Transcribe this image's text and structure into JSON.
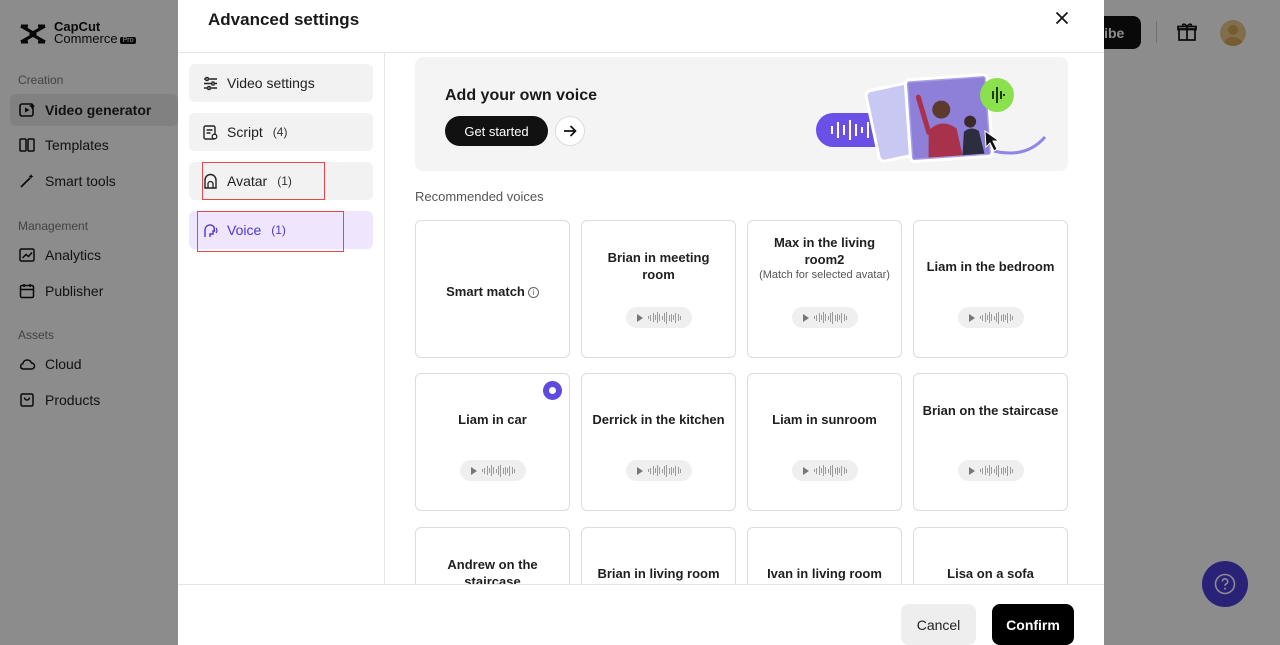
{
  "app": {
    "logo_line1": "CapCut",
    "logo_line2": "Commerce",
    "logo_badge": "Pro",
    "subscribe_label": "ribe",
    "sections": [
      {
        "label": "Creation",
        "items": [
          "Video generator",
          "Templates",
          "Smart tools"
        ]
      },
      {
        "label": "Management",
        "items": [
          "Analytics",
          "Publisher"
        ]
      },
      {
        "label": "Assets",
        "items": [
          "Cloud",
          "Products"
        ]
      }
    ],
    "accent_color": "#4c3ed8"
  },
  "modal": {
    "title": "Advanced settings",
    "nav": [
      {
        "label": "Video settings",
        "count": ""
      },
      {
        "label": "Script",
        "count": "(4)"
      },
      {
        "label": "Avatar",
        "count": "(1)"
      },
      {
        "label": "Voice",
        "count": "(1)"
      }
    ],
    "active_nav": "Voice",
    "banner": {
      "title": "Add your own voice",
      "button_label": "Get started"
    },
    "section_label": "Recommended voices",
    "voices": [
      {
        "name": "Smart match",
        "note": "",
        "selected": false
      },
      {
        "name": "Brian in meeting room",
        "note": "",
        "selected": false
      },
      {
        "name": "Max in the living room2",
        "note": "(Match for selected avatar)",
        "selected": false
      },
      {
        "name": "Liam in the bedroom",
        "note": "",
        "selected": false
      },
      {
        "name": "Liam in car",
        "note": "",
        "selected": true
      },
      {
        "name": "Derrick in the kitchen",
        "note": "",
        "selected": false
      },
      {
        "name": "Liam in sunroom",
        "note": "",
        "selected": false
      },
      {
        "name": "Brian on the staircase",
        "note": "",
        "selected": false
      },
      {
        "name": "Andrew on the staircase",
        "note": "",
        "selected": false
      },
      {
        "name": "Brian in living room",
        "note": "",
        "selected": false
      },
      {
        "name": "Ivan in living room",
        "note": "",
        "selected": false
      },
      {
        "name": "Lisa on a sofa",
        "note": "",
        "selected": false
      }
    ],
    "footer": {
      "cancel_label": "Cancel",
      "confirm_label": "Confirm"
    }
  }
}
